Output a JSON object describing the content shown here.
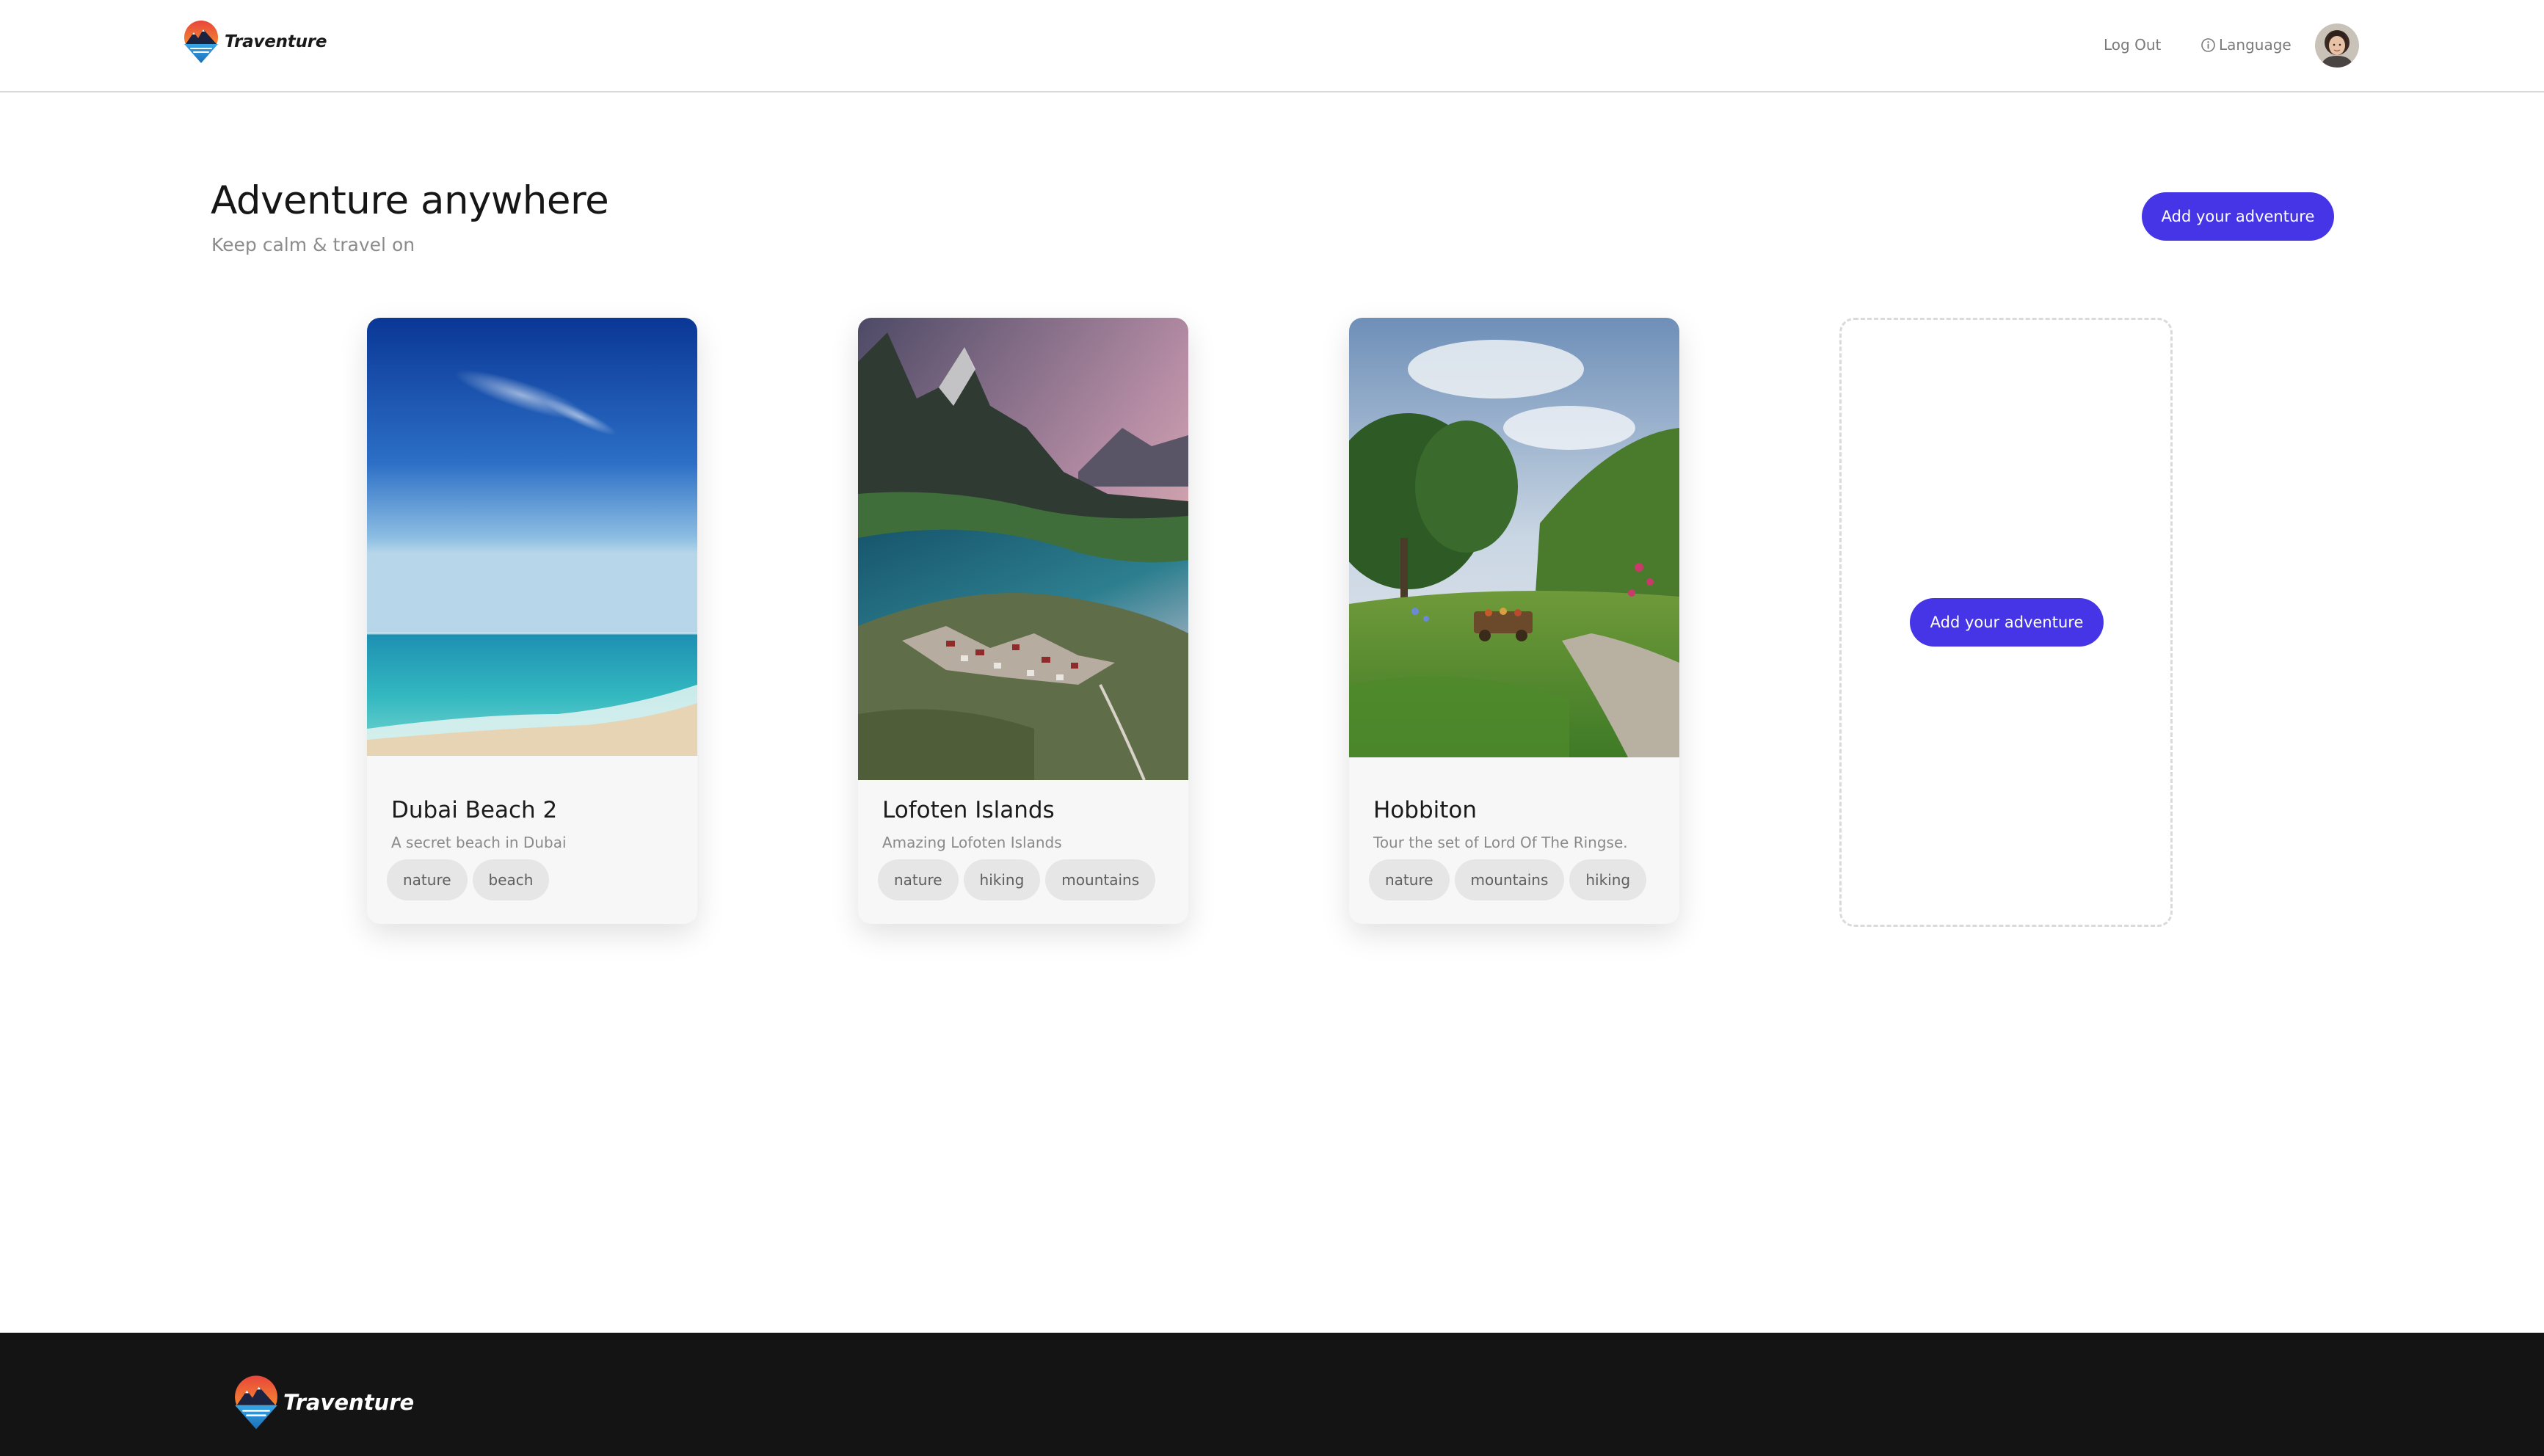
{
  "header": {
    "brand_name": "Traventure",
    "logout_label": "Log Out",
    "language_label": "Language"
  },
  "hero": {
    "title": "Adventure anywhere",
    "subtitle": "Keep calm & travel on",
    "add_button_label": "Add your adventure"
  },
  "cards": [
    {
      "title": "Dubai Beach 2",
      "description": "A secret beach in Dubai",
      "image": "beach-photo",
      "tags": [
        "nature",
        "beach"
      ]
    },
    {
      "title": "Lofoten Islands",
      "description": "Amazing Lofoten Islands",
      "image": "fjord-village-photo",
      "tags": [
        "nature",
        "hiking",
        "mountains"
      ]
    },
    {
      "title": "Hobbiton",
      "description": "Tour the set of Lord Of The Ringse.",
      "image": "hobbiton-garden-photo",
      "tags": [
        "nature",
        "mountains",
        "hiking"
      ]
    }
  ],
  "add_card": {
    "button_label": "Add your adventure"
  },
  "footer": {
    "brand_name": "Traventure"
  },
  "colors": {
    "accent": "#4535e6",
    "footer_bg": "#141414",
    "tag_bg": "#e6e6e6",
    "card_bg": "#f7f7f7"
  }
}
